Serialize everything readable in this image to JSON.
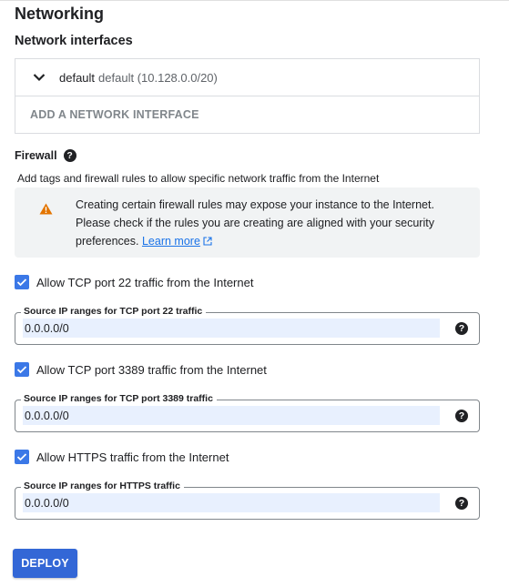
{
  "section_title": "Networking",
  "network_interfaces": {
    "title": "Network interfaces",
    "interface": {
      "name": "default",
      "detail": "default (10.128.0.0/20)"
    },
    "add_label": "ADD A NETWORK INTERFACE"
  },
  "firewall": {
    "title": "Firewall",
    "help_icon": "?",
    "description": "Add tags and firewall rules to allow specific network traffic from the Internet",
    "warning": {
      "text": "Creating certain firewall rules may expose your instance to the Internet. Please check if the rules you are creating are aligned with your security preferences.",
      "link_label": "Learn more",
      "color": "#e37400"
    },
    "rules": [
      {
        "checkbox_label": "Allow TCP port 22 traffic from the Internet",
        "checked": true,
        "field_label": "Source IP ranges for TCP port 22 traffic",
        "value": "0.0.0.0/0"
      },
      {
        "checkbox_label": "Allow TCP port 3389 traffic from the Internet",
        "checked": true,
        "field_label": "Source IP ranges for TCP port 3389 traffic",
        "value": "0.0.0.0/0"
      },
      {
        "checkbox_label": "Allow HTTPS traffic from the Internet",
        "checked": true,
        "field_label": "Source IP ranges for HTTPS traffic",
        "value": "0.0.0.0/0"
      }
    ]
  },
  "deploy_label": "DEPLOY",
  "colors": {
    "accent": "#3367d6",
    "checkbox": "#3b78e7",
    "input_fill": "#e8f0fe",
    "link": "#1a73e8"
  }
}
